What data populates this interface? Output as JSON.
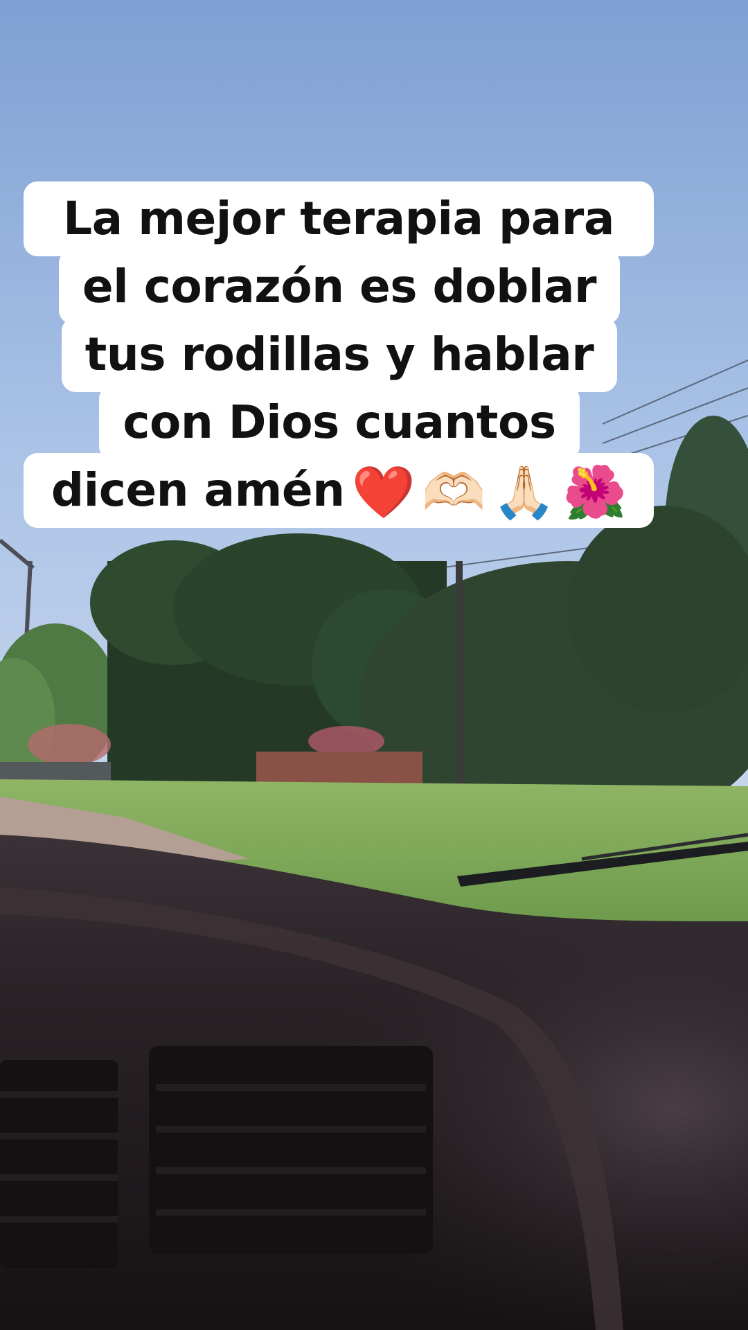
{
  "caption": {
    "lines": [
      "La mejor terapia para",
      "el corazón es doblar",
      "tus rodillas y hablar",
      "con Dios cuantos",
      "dicen amén"
    ],
    "emojis": {
      "heart": "❤️",
      "hands_heart": "🫶🏻",
      "pray": "🙏🏻",
      "flower": "🌺"
    }
  }
}
